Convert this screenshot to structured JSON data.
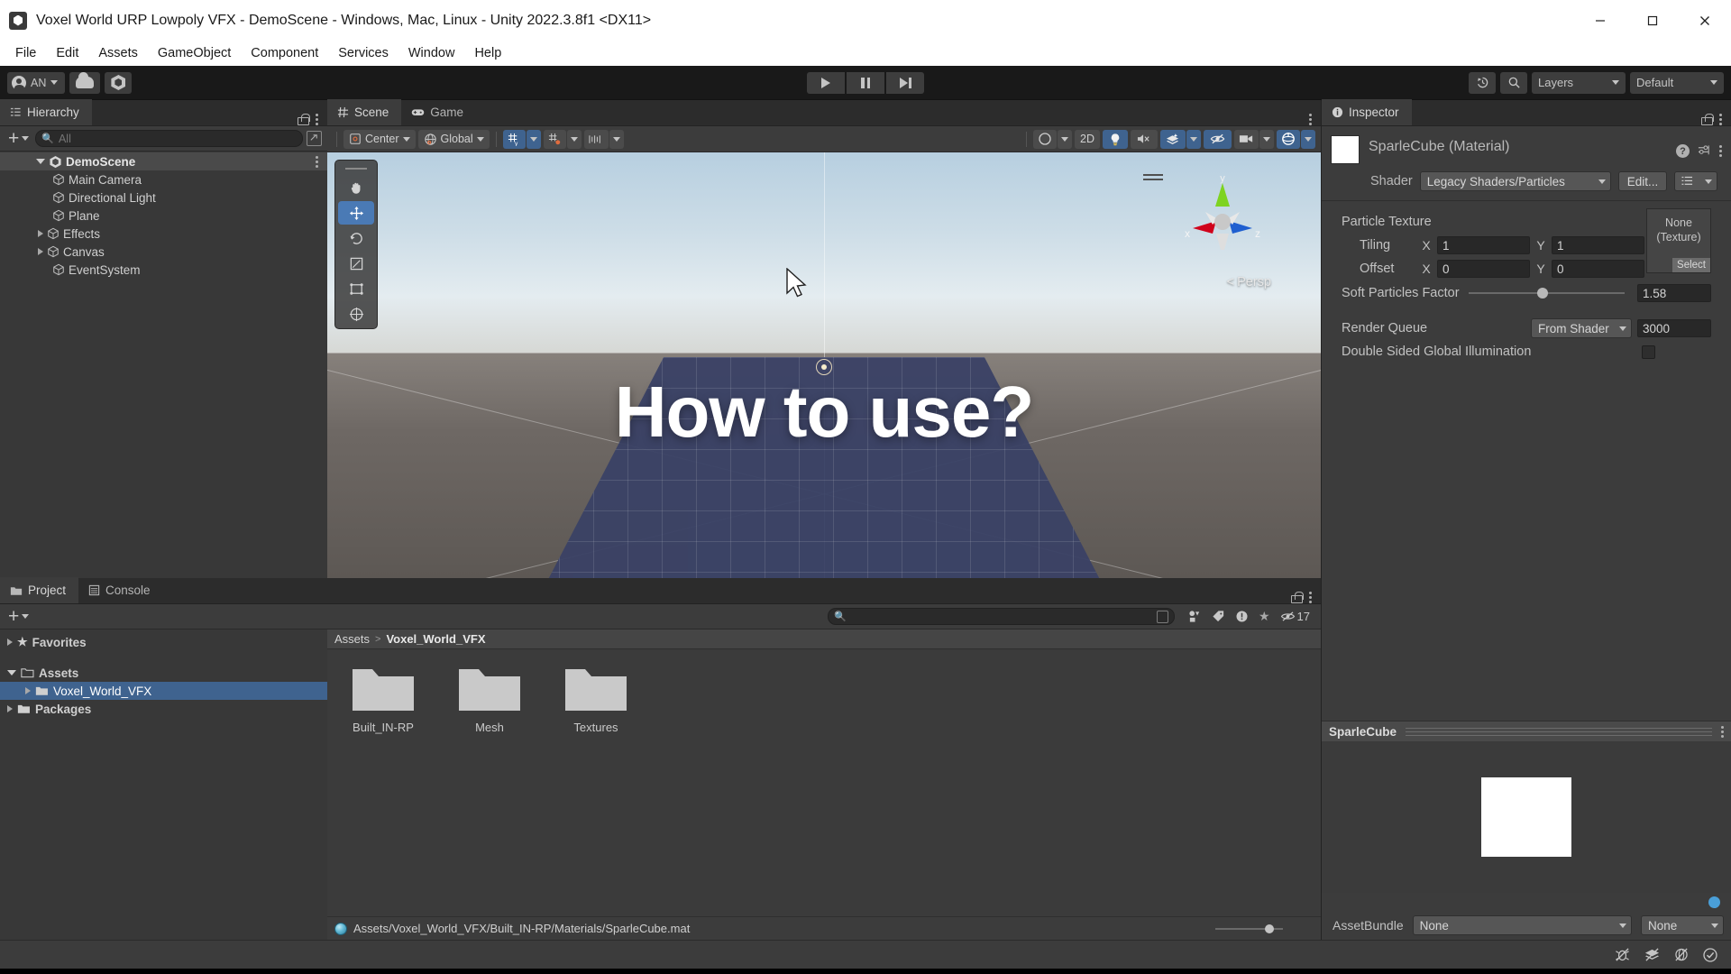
{
  "window": {
    "title": "Voxel World URP Lowpoly VFX - DemoScene - Windows, Mac, Linux - Unity 2022.3.8f1 <DX11>",
    "minimize": "–",
    "maximize": "□",
    "close": "✕"
  },
  "menubar": {
    "items": [
      "File",
      "Edit",
      "Assets",
      "GameObject",
      "Component",
      "Services",
      "Window",
      "Help"
    ]
  },
  "toolbar": {
    "account_label": "AN",
    "cloud_label": "",
    "services_label": "",
    "layers_label": "Layers",
    "layout_label": "Default"
  },
  "hierarchy": {
    "tab_label": "Hierarchy",
    "search_placeholder": "All",
    "search_value": "",
    "scene_name": "DemoScene",
    "items": [
      {
        "label": "Main Camera",
        "expandable": false
      },
      {
        "label": "Directional Light",
        "expandable": false
      },
      {
        "label": "Plane",
        "expandable": false
      },
      {
        "label": "Effects",
        "expandable": true
      },
      {
        "label": "Canvas",
        "expandable": true
      },
      {
        "label": "EventSystem",
        "expandable": false
      }
    ]
  },
  "scene": {
    "tabs": [
      {
        "label": "Scene",
        "active": true
      },
      {
        "label": "Game",
        "active": false
      }
    ],
    "pivot_label": "Center",
    "space_label": "Global",
    "2d_label": "2D",
    "overlay_text": "How to use?",
    "persp_label": "Persp",
    "gizmo_axes": {
      "x": "x",
      "y": "y",
      "z": "z"
    }
  },
  "project": {
    "tabs": [
      {
        "label": "Project",
        "active": true
      },
      {
        "label": "Console",
        "active": false
      }
    ],
    "search_placeholder": "",
    "hidden_count": "17",
    "tree": [
      {
        "label": "Favorites",
        "indent": 0,
        "expandable": true,
        "bold": true,
        "icon": "star-icon",
        "selected": false
      },
      {
        "label": "Assets",
        "indent": 0,
        "expandable": true,
        "bold": true,
        "icon": "folder-icon",
        "selected": false
      },
      {
        "label": "Voxel_World_VFX",
        "indent": 1,
        "expandable": true,
        "bold": false,
        "icon": "folder-icon",
        "selected": true
      },
      {
        "label": "Packages",
        "indent": 0,
        "expandable": true,
        "bold": true,
        "icon": "folder-icon",
        "selected": false
      }
    ],
    "breadcrumb": {
      "root": "Assets",
      "separator": ">",
      "current": "Voxel_World_VFX"
    },
    "assets": [
      {
        "label": "Built_IN-RP",
        "type": "folder"
      },
      {
        "label": "Mesh",
        "type": "folder"
      },
      {
        "label": "Textures",
        "type": "folder"
      }
    ],
    "status_path": "Assets/Voxel_World_VFX/Built_IN-RP/Materials/SparleCube.mat"
  },
  "inspector": {
    "tab_label": "Inspector",
    "material_title": "SparleCube (Material)",
    "shader_label": "Shader",
    "shader_value": "Legacy Shaders/Particles",
    "edit_label": "Edit...",
    "particle_texture_label": "Particle Texture",
    "texture_slot": {
      "line1": "None",
      "line2": "(Texture)",
      "select_label": "Select"
    },
    "tiling": {
      "label": "Tiling",
      "x_axis": "X",
      "x": "1",
      "y_axis": "Y",
      "y": "1"
    },
    "offset": {
      "label": "Offset",
      "x_axis": "X",
      "x": "0",
      "y_axis": "Y",
      "y": "0"
    },
    "soft_particles": {
      "label": "Soft Particles Factor",
      "value": "1.58"
    },
    "render_queue": {
      "label": "Render Queue",
      "mode": "From Shader",
      "value": "3000"
    },
    "double_sided_gi": {
      "label": "Double Sided Global Illumination",
      "checked": false
    },
    "preview_title": "SparleCube",
    "assetbundle": {
      "label": "AssetBundle",
      "value": "None",
      "variant": "None"
    }
  }
}
